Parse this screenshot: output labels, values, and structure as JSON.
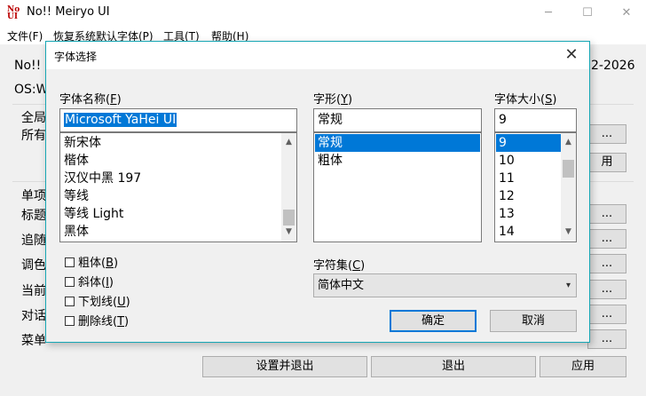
{
  "app": {
    "title": "No!! Meiryo UI",
    "icon_glyph_top": "No",
    "icon_glyph_bottom": "UI",
    "window_controls": [
      "minimize-icon",
      "maximize-icon",
      "close-icon"
    ]
  },
  "menubar": {
    "items": [
      "文件(F)",
      "恢复系统默认字体(P)",
      "工具(T)",
      "帮助(H)"
    ]
  },
  "background": {
    "heading_left": "No!!",
    "heading_right": "2-2026",
    "os_label": "OS:W",
    "group1_labels": [
      "全局",
      "所有"
    ],
    "group2_labels": [
      "单项",
      "标题",
      "追随",
      "调色",
      "当前",
      "对话",
      "菜单"
    ],
    "side_buttons": [
      "...",
      "用",
      "...",
      "...",
      "...",
      "...",
      "...",
      "..."
    ],
    "bottom_buttons": [
      "设置并退出",
      "退出",
      "应用"
    ]
  },
  "dialog": {
    "title": "字体选择",
    "font_name": {
      "label": "字体名称(",
      "mnemonic": "F",
      "label_end": ")",
      "value": "Microsoft YaHei UI",
      "items": [
        "新宋体",
        "楷体",
        "汉仪中黑 197",
        "等线",
        "等线 Light",
        "黑体"
      ]
    },
    "font_style": {
      "label": "字形(",
      "mnemonic": "Y",
      "label_end": ")",
      "value": "常规",
      "items": [
        "常规",
        "粗体"
      ],
      "selected_index": 0
    },
    "font_size": {
      "label": "字体大小(",
      "mnemonic": "S",
      "label_end": ")",
      "value": "9",
      "items": [
        "9",
        "10",
        "11",
        "12",
        "13",
        "14"
      ],
      "selected_index": 0
    },
    "effects": [
      {
        "label": "粗体(",
        "mnemonic": "B",
        "label_end": ")",
        "checked": false
      },
      {
        "label": "斜体(",
        "mnemonic": "I",
        "label_end": ")",
        "checked": false
      },
      {
        "label": "下划线(",
        "mnemonic": "U",
        "label_end": ")",
        "checked": false
      },
      {
        "label": "删除线(",
        "mnemonic": "T",
        "label_end": ")",
        "checked": false
      }
    ],
    "charset": {
      "label": "字符集(",
      "mnemonic": "C",
      "label_end": ")",
      "value": "简体中文"
    },
    "ok_label": "确定",
    "cancel_label": "取消",
    "close_glyph": "✕"
  }
}
